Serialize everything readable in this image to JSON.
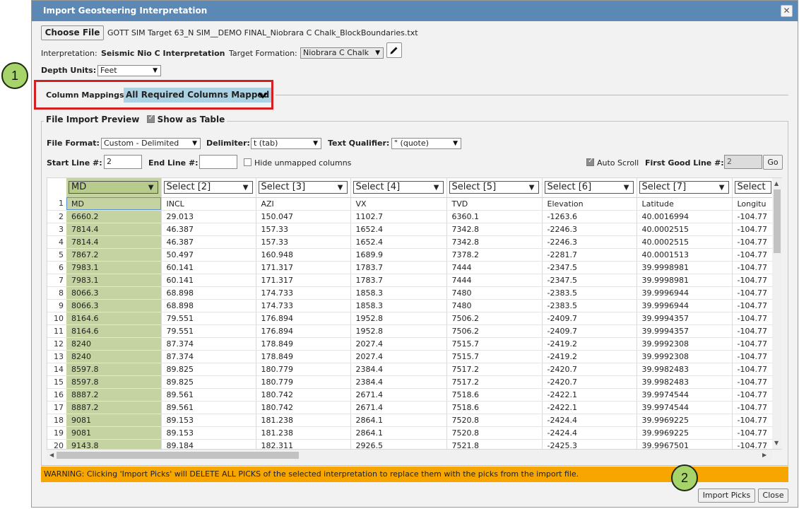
{
  "dialog": {
    "title": "Import Geosteering Interpretation",
    "close_icon": "close-icon",
    "choose_file_label": "Choose File",
    "file_name": "GOTT SIM Target 63_N SIM__DEMO FINAL_Niobrara C Chalk_BlockBoundaries.txt",
    "interpretation_label": "Interpretation:",
    "interpretation_value": "Seismic Nio C Interpretation",
    "target_formation_label": "Target Formation:",
    "target_formation_value": "Niobrara C Chalk",
    "edit_icon": "pencil-icon",
    "depth_units_label": "Depth Units:",
    "depth_units_value": "Feet",
    "column_mappings_label": "Column Mappings",
    "column_mappings_status": "All Required Columns Mapped",
    "expand_icon": "chevron-down-icon"
  },
  "callouts": {
    "one": "1",
    "two": "2"
  },
  "preview": {
    "legend": "File Import Preview",
    "show_as_table_label": "Show as Table",
    "show_as_table_checked": true,
    "file_format_label": "File Format:",
    "file_format_value": "Custom - Delimited",
    "delimiter_label": "Delimiter:",
    "delimiter_value": "t (tab)",
    "text_qualifier_label": "Text Qualifier:",
    "text_qualifier_value": "\" (quote)",
    "start_line_label": "Start Line #:",
    "start_line_value": "2",
    "end_line_label": "End Line #:",
    "end_line_value": "",
    "hide_unmapped_label": "Hide unmapped columns",
    "auto_scroll_label": "Auto Scroll",
    "auto_scroll_checked": true,
    "first_good_line_label": "First Good Line #:",
    "first_good_line_value": "2",
    "go_label": "Go"
  },
  "table": {
    "column_selects": [
      "MD",
      "Select [2]",
      "Select [3]",
      "Select [4]",
      "Select [5]",
      "Select [6]",
      "Select [7]",
      "Select"
    ],
    "rows": [
      [
        "1",
        "MD",
        "INCL",
        "AZI",
        "VX",
        "TVD",
        "Elevation",
        "Latitude",
        "Longitu"
      ],
      [
        "2",
        "6660.2",
        "29.013",
        "150.047",
        "1102.7",
        "6360.1",
        "-1263.6",
        "40.0016994",
        "-104.77"
      ],
      [
        "3",
        "7814.4",
        "46.387",
        "157.33",
        "1652.4",
        "7342.8",
        "-2246.3",
        "40.0002515",
        "-104.77"
      ],
      [
        "4",
        "7814.4",
        "46.387",
        "157.33",
        "1652.4",
        "7342.8",
        "-2246.3",
        "40.0002515",
        "-104.77"
      ],
      [
        "5",
        "7867.2",
        "50.497",
        "160.948",
        "1689.9",
        "7378.2",
        "-2281.7",
        "40.0001513",
        "-104.77"
      ],
      [
        "6",
        "7983.1",
        "60.141",
        "171.317",
        "1783.7",
        "7444",
        "-2347.5",
        "39.9998981",
        "-104.77"
      ],
      [
        "7",
        "7983.1",
        "60.141",
        "171.317",
        "1783.7",
        "7444",
        "-2347.5",
        "39.9998981",
        "-104.77"
      ],
      [
        "8",
        "8066.3",
        "68.898",
        "174.733",
        "1858.3",
        "7480",
        "-2383.5",
        "39.9996944",
        "-104.77"
      ],
      [
        "9",
        "8066.3",
        "68.898",
        "174.733",
        "1858.3",
        "7480",
        "-2383.5",
        "39.9996944",
        "-104.77"
      ],
      [
        "10",
        "8164.6",
        "79.551",
        "176.894",
        "1952.8",
        "7506.2",
        "-2409.7",
        "39.9994357",
        "-104.77"
      ],
      [
        "11",
        "8164.6",
        "79.551",
        "176.894",
        "1952.8",
        "7506.2",
        "-2409.7",
        "39.9994357",
        "-104.77"
      ],
      [
        "12",
        "8240",
        "87.374",
        "178.849",
        "2027.4",
        "7515.7",
        "-2419.2",
        "39.9992308",
        "-104.77"
      ],
      [
        "13",
        "8240",
        "87.374",
        "178.849",
        "2027.4",
        "7515.7",
        "-2419.2",
        "39.9992308",
        "-104.77"
      ],
      [
        "14",
        "8597.8",
        "89.825",
        "180.779",
        "2384.4",
        "7517.2",
        "-2420.7",
        "39.9982483",
        "-104.77"
      ],
      [
        "15",
        "8597.8",
        "89.825",
        "180.779",
        "2384.4",
        "7517.2",
        "-2420.7",
        "39.9982483",
        "-104.77"
      ],
      [
        "16",
        "8887.2",
        "89.561",
        "180.742",
        "2671.4",
        "7518.6",
        "-2422.1",
        "39.9974544",
        "-104.77"
      ],
      [
        "17",
        "8887.2",
        "89.561",
        "180.742",
        "2671.4",
        "7518.6",
        "-2422.1",
        "39.9974544",
        "-104.77"
      ],
      [
        "18",
        "9081",
        "89.153",
        "181.238",
        "2864.1",
        "7520.8",
        "-2424.4",
        "39.9969225",
        "-104.77"
      ],
      [
        "19",
        "9081",
        "89.153",
        "181.238",
        "2864.1",
        "7520.8",
        "-2424.4",
        "39.9969225",
        "-104.77"
      ],
      [
        "20",
        "9143.8",
        "89.184",
        "182.311",
        "2926.5",
        "7521.8",
        "-2425.3",
        "39.9967501",
        "-104.77"
      ]
    ]
  },
  "warning": "WARNING: Clicking 'Import Picks' will DELETE ALL PICKS of the selected interpretation to replace them with the picks from the import file.",
  "footer": {
    "import_label": "Import Picks",
    "close_label": "Close"
  },
  "colors": {
    "titlebar": "#5b88b5",
    "md_column": "#c5d3a2",
    "warning": "#f7a600",
    "mapped_pill": "#aad2e3",
    "callout": "#a6d36a",
    "highlight": "#d42020"
  }
}
